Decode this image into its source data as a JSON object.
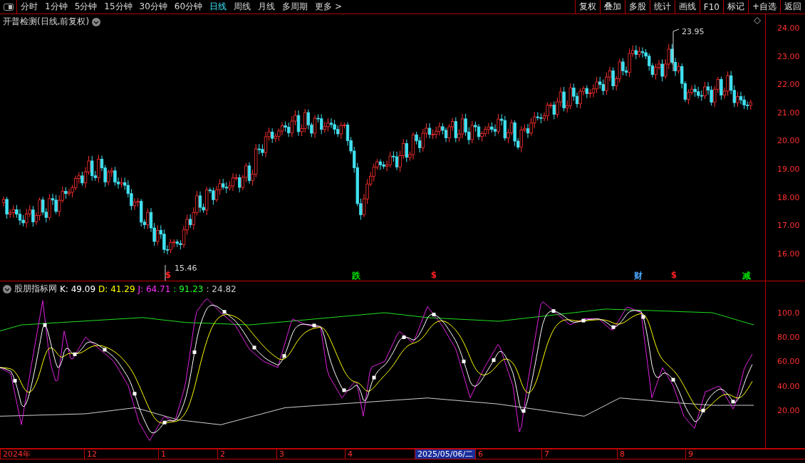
{
  "toolbar": {
    "periods": [
      {
        "label": "分时",
        "selected": false
      },
      {
        "label": "1分钟",
        "selected": false
      },
      {
        "label": "5分钟",
        "selected": false
      },
      {
        "label": "15分钟",
        "selected": false
      },
      {
        "label": "30分钟",
        "selected": false
      },
      {
        "label": "60分钟",
        "selected": false
      },
      {
        "label": "日线",
        "selected": true
      },
      {
        "label": "周线",
        "selected": false
      },
      {
        "label": "月线",
        "selected": false
      },
      {
        "label": "多周期",
        "selected": false
      },
      {
        "label": "更多 >",
        "selected": false
      }
    ],
    "actions": [
      "复权",
      "叠加",
      "多股",
      "统计",
      "画线",
      "F10",
      "标记",
      "+自选",
      "返回"
    ]
  },
  "price_panel": {
    "title": "开普检测(日线,前复权)",
    "high_label": "23.95",
    "low_label": "15.46",
    "markers": [
      {
        "text": "$",
        "color": "#ff2020"
      },
      {
        "text": "跌",
        "color": "#00e000"
      },
      {
        "text": "$",
        "color": "#ff2020"
      },
      {
        "text": "财",
        "color": "#4aa8ff"
      },
      {
        "text": "$",
        "color": "#ff2020"
      },
      {
        "text": "减",
        "color": "#00e000"
      }
    ],
    "axis": [
      "24.00",
      "23.00",
      "22.00",
      "21.00",
      "20.00",
      "19.00",
      "18.00",
      "17.00",
      "16.00"
    ]
  },
  "indicator_panel": {
    "name": "股朋指标网",
    "readings": [
      {
        "text": "K: 49.09",
        "color": "#ffffff"
      },
      {
        "text": "D: 41.29",
        "color": "#ffff00"
      },
      {
        "text": "J: 64.71",
        "color": "#ff30ff"
      },
      {
        "text": ": 91.23",
        "color": "#20ff20"
      },
      {
        "text": ": 24.82",
        "color": "#c8c8c8"
      }
    ],
    "axis": [
      "100.0",
      "80.00",
      "60.00",
      "40.00",
      "20.00"
    ]
  },
  "date_axis": [
    {
      "label": "2024年",
      "selected": false
    },
    {
      "label": "12",
      "selected": false
    },
    {
      "label": "1",
      "selected": false
    },
    {
      "label": "2",
      "selected": false
    },
    {
      "label": "3",
      "selected": false
    },
    {
      "label": "4",
      "selected": false
    },
    {
      "label": "2025/05/06/二",
      "selected": true
    },
    {
      "label": "6",
      "selected": false
    },
    {
      "label": "7",
      "selected": false
    },
    {
      "label": "8",
      "selected": false
    },
    {
      "label": "9",
      "selected": false
    }
  ]
}
